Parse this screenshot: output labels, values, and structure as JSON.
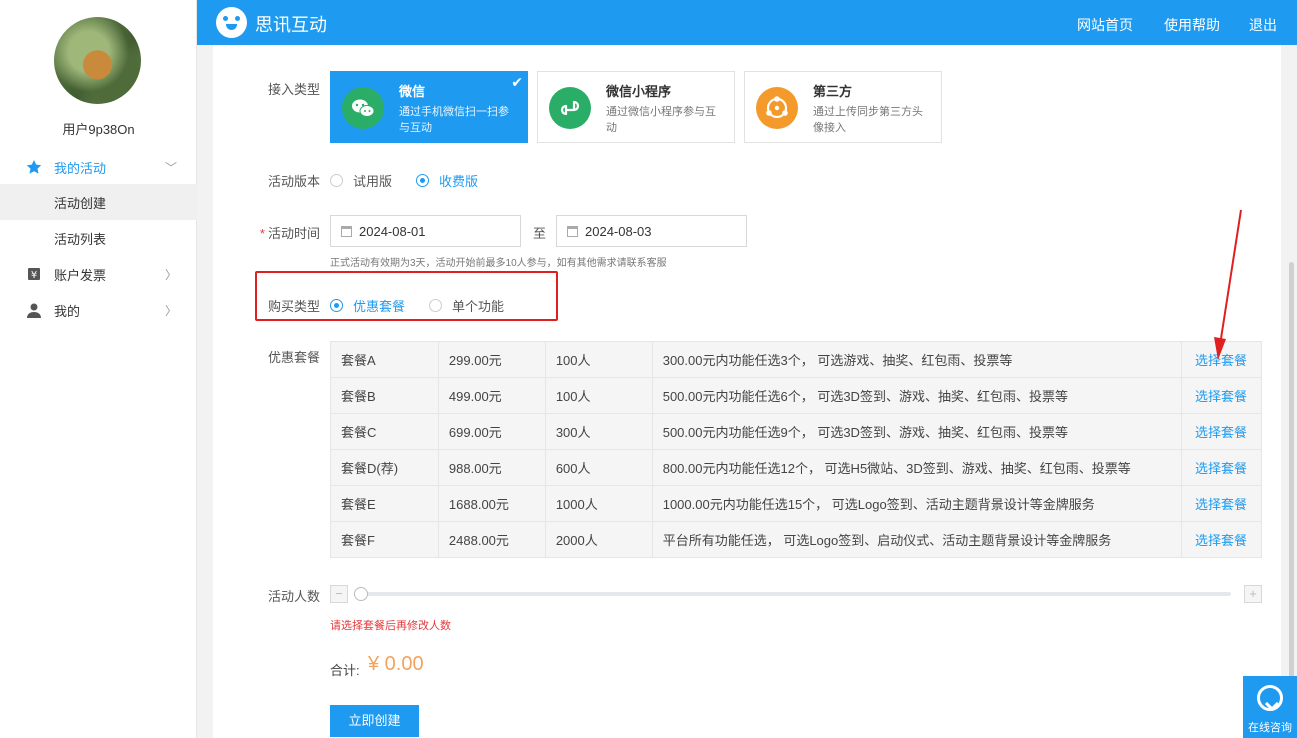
{
  "sidebar": {
    "username": "用户9p38On",
    "menu": [
      {
        "label": "我的活动",
        "icon": "star-icon",
        "arrow": "﹀"
      },
      {
        "label": "活动创建"
      },
      {
        "label": "活动列表"
      },
      {
        "label": "账户发票",
        "icon": "invoice-icon",
        "arrow": "〉"
      },
      {
        "label": "我的",
        "icon": "user-icon",
        "arrow": "〉"
      }
    ]
  },
  "header": {
    "brand": "思讯互动",
    "nav": [
      "网站首页",
      "使用帮助",
      "退出"
    ]
  },
  "form": {
    "access_label": "接入类型",
    "access_types": [
      {
        "title": "微信",
        "desc": "通过手机微信扫一扫参与互动",
        "selected": true
      },
      {
        "title": "微信小程序",
        "desc": "通过微信小程序参与互动",
        "selected": false
      },
      {
        "title": "第三方",
        "desc": "通过上传同步第三方头像接入",
        "selected": false
      }
    ],
    "version_label": "活动版本",
    "versions": [
      "试用版",
      "收费版"
    ],
    "time_label": "活动时间",
    "time_required": "*",
    "start_date": "2024-08-01",
    "to_text": "至",
    "end_date": "2024-08-03",
    "time_tip": "正式活动有效期为3天，活动开始前最多10人参与，如有其他需求请联系客服",
    "purchase_label": "购买类型",
    "purchase_types": [
      "优惠套餐",
      "单个功能"
    ],
    "package_label": "优惠套餐",
    "packages": [
      {
        "name": "套餐A",
        "price": "299.00元",
        "people": "100人",
        "desc": "300.00元内功能任选3个， 可选游戏、抽奖、红包雨、投票等",
        "action": "选择套餐"
      },
      {
        "name": "套餐B",
        "price": "499.00元",
        "people": "100人",
        "desc": "500.00元内功能任选6个， 可选3D签到、游戏、抽奖、红包雨、投票等",
        "action": "选择套餐"
      },
      {
        "name": "套餐C",
        "price": "699.00元",
        "people": "300人",
        "desc": "500.00元内功能任选9个， 可选3D签到、游戏、抽奖、红包雨、投票等",
        "action": "选择套餐"
      },
      {
        "name": "套餐D(荐)",
        "price": "988.00元",
        "people": "600人",
        "desc": "800.00元内功能任选12个， 可选H5微站、3D签到、游戏、抽奖、红包雨、投票等",
        "action": "选择套餐"
      },
      {
        "name": "套餐E",
        "price": "1688.00元",
        "people": "1000人",
        "desc": "1000.00元内功能任选15个， 可选Logo签到、活动主题背景设计等金牌服务",
        "action": "选择套餐"
      },
      {
        "name": "套餐F",
        "price": "2488.00元",
        "people": "2000人",
        "desc": "平台所有功能任选， 可选Logo签到、启动仪式、活动主题背景设计等金牌服务",
        "action": "选择套餐"
      }
    ],
    "people_label": "活动人数",
    "minus": "−",
    "plus": "+",
    "people_warn": "请选择套餐后再修改人数",
    "total_label": "合计:",
    "total_value": "¥ 0.00",
    "submit": "立即创建"
  },
  "chat": {
    "label": "在线咨询"
  },
  "colors": {
    "accent": "#1e9bf0",
    "annotation": "#e02020",
    "price": "#f5a35c"
  }
}
